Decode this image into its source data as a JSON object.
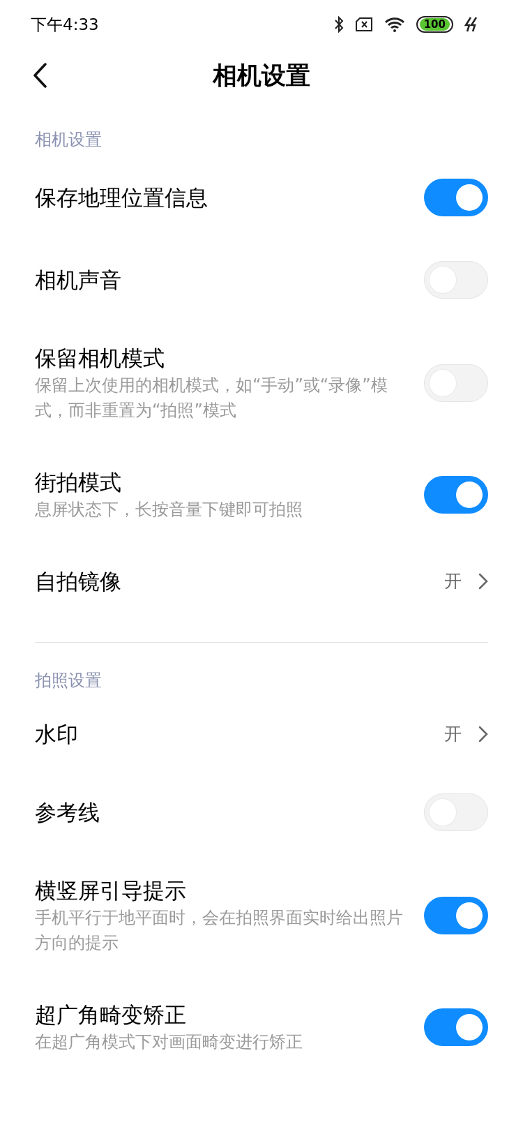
{
  "status_bar": {
    "time": "下午4:33",
    "battery": "100"
  },
  "header": {
    "title": "相机设置"
  },
  "sections": [
    {
      "label": "相机设置",
      "items": [
        {
          "kind": "toggle",
          "title": "保存地理位置信息",
          "on": true
        },
        {
          "kind": "toggle",
          "title": "相机声音",
          "on": false
        },
        {
          "kind": "toggle",
          "title": "保留相机模式",
          "description": "保留上次使用的相机模式，如“手动”或“录像”模式，而非重置为“拍照”模式",
          "on": false
        },
        {
          "kind": "toggle",
          "title": "街拍模式",
          "description": "息屏状态下，长按音量下键即可拍照",
          "on": true
        },
        {
          "kind": "link",
          "title": "自拍镜像",
          "value": "开"
        }
      ]
    },
    {
      "label": "拍照设置",
      "items": [
        {
          "kind": "link",
          "title": "水印",
          "value": "开"
        },
        {
          "kind": "toggle",
          "title": "参考线",
          "on": false
        },
        {
          "kind": "toggle",
          "title": "横竖屏引导提示",
          "description": "手机平行于地平面时，会在拍照界面实时给出照片方向的提示",
          "on": true
        },
        {
          "kind": "toggle",
          "title": "超广角畸变矫正",
          "description": "在超广角模式下对画面畸变进行矫正",
          "on": true
        }
      ]
    }
  ]
}
